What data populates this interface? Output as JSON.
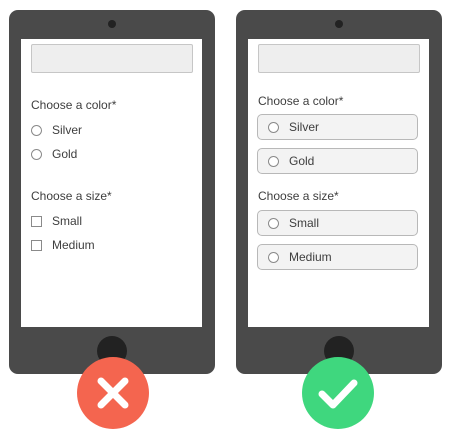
{
  "bad_example": {
    "color_label": "Choose a color*",
    "color_options": [
      "Silver",
      "Gold"
    ],
    "size_label": "Choose a size*",
    "size_options": [
      "Small",
      "Medium"
    ],
    "verdict_icon": "x-icon",
    "verdict_color": "#f4654f"
  },
  "good_example": {
    "color_label": "Choose a color*",
    "color_options": [
      "Silver",
      "Gold"
    ],
    "size_label": "Choose a size*",
    "size_options": [
      "Small",
      "Medium"
    ],
    "verdict_icon": "check-icon",
    "verdict_color": "#3fd77e"
  }
}
